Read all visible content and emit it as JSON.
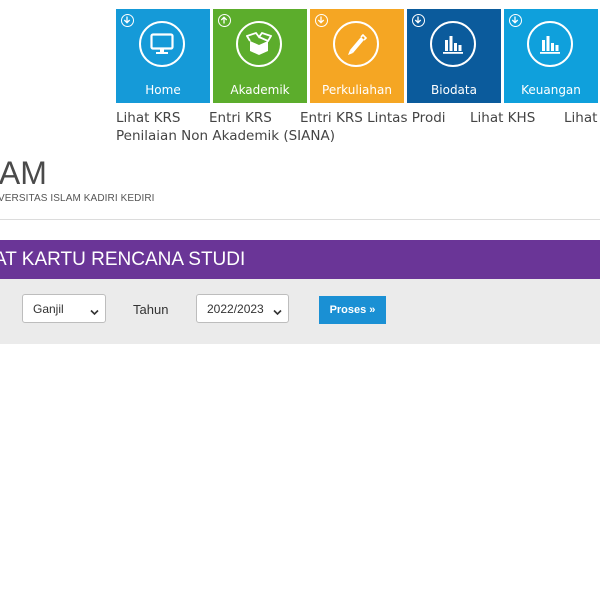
{
  "tiles": [
    {
      "label": "Home",
      "color": "#159ad8",
      "icon": "monitor-icon",
      "arrow": "download-arrow-icon"
    },
    {
      "label": "Akademik",
      "color": "#5cad2c",
      "icon": "open-box-icon",
      "arrow": "upload-arrow-icon"
    },
    {
      "label": "Perkuliahan",
      "color": "#f5a623",
      "icon": "pencil-icon",
      "arrow": "download-arrow-icon"
    },
    {
      "label": "Biodata",
      "color": "#0b5b9c",
      "icon": "bar-chart-icon",
      "arrow": "download-arrow-icon"
    },
    {
      "label": "Keuangan",
      "color": "#0fa0dc",
      "icon": "bar-chart-icon",
      "arrow": "download-arrow-icon"
    }
  ],
  "menu": {
    "lihat_krs": "Lihat KRS",
    "entri_krs": "Entri KRS",
    "entri_krs_lintas_prodi": "Entri KRS Lintas Prodi",
    "lihat_khs": "Lihat KHS",
    "lihat_more": "Lihat",
    "penilaian_non_akademik": "Penilaian Non Akademik (SIANA)"
  },
  "brand": {
    "title": "IAM",
    "subtitle": "VERSITAS ISLAM KADIRI KEDIRI"
  },
  "banner": {
    "title": "AT KARTU RENCANA STUDI",
    "color": "#6a3597"
  },
  "filters": {
    "semester_value": "Ganjil",
    "tahun_label": "Tahun",
    "tahun_value": "2022/2023",
    "proses_label": "Proses »"
  }
}
